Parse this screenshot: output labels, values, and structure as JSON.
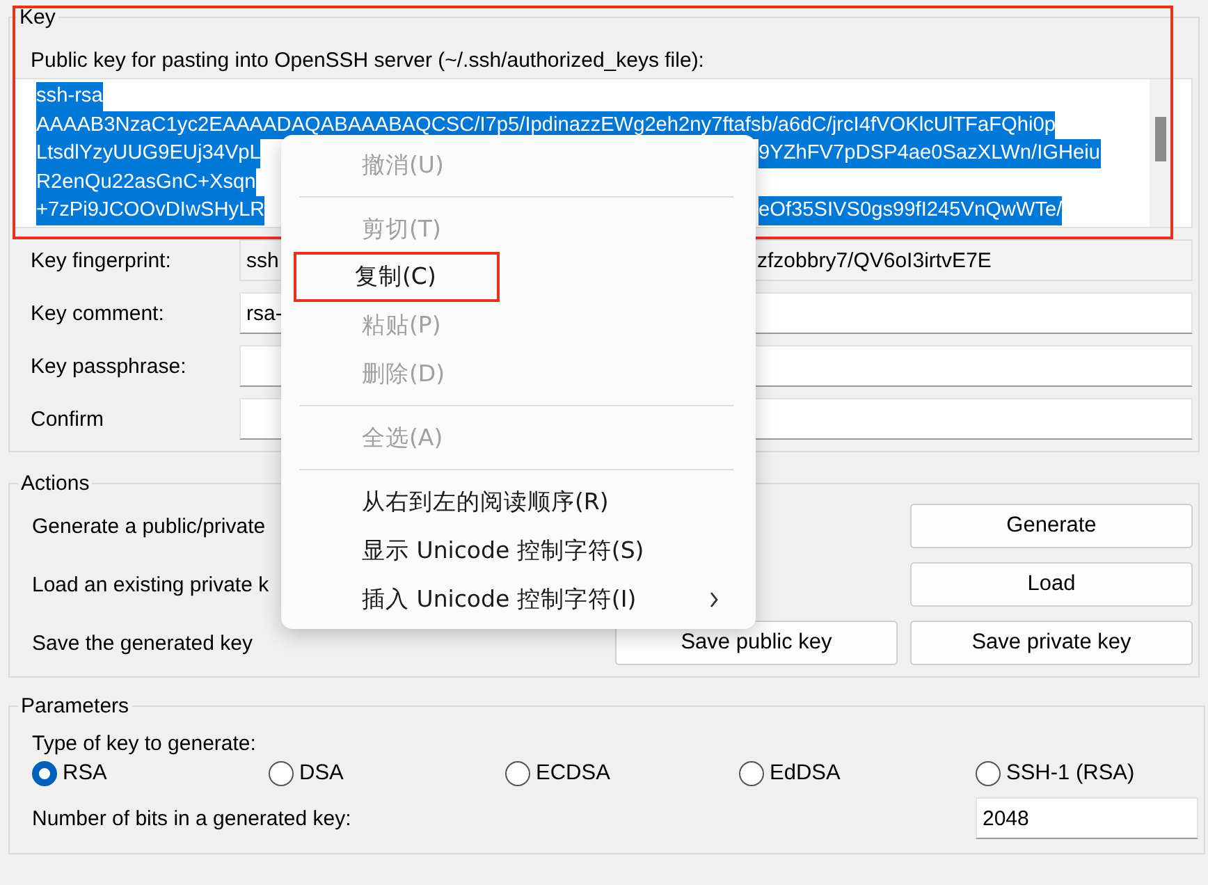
{
  "key_group": {
    "title": "Key",
    "annotated": true,
    "public_key_label": "Public key for pasting into OpenSSH server (~/.ssh/authorized_keys file):",
    "text_selected": true,
    "public_key_lines": [
      {
        "left": "ssh-rsa"
      },
      {
        "left": "AAAAB3NzaC1yc2EAAAADAQABAAABAQCSC/I7p5/IpdinazzEWg2eh2ny7ftafsb/a6dC/jrcI4fVOKlcUlTFaFQhi0p"
      },
      {
        "left": "LtsdlYzyUUG9EUj34VpL",
        "right": "9YZhFV7pDSP4ae0SazXLWn/IGHeiu"
      },
      {
        "left": "R2enQu22asGnC+Xsqn"
      },
      {
        "left": "+7zPi9JCOOvDIwSHyLR",
        "right": "eOf35SIVS0gs99fI245VnQwWTe/"
      }
    ],
    "fields": [
      {
        "label": "Key fingerprint:",
        "value_left": "ssh",
        "value_right": "zfzobbry7/QV6oI3irtvE7E",
        "readonly": true
      },
      {
        "label": "Key comment:",
        "value_left": "rsa-",
        "readonly": false
      },
      {
        "label": "Key passphrase:",
        "readonly": false
      },
      {
        "label": "Confirm",
        "readonly": false
      }
    ]
  },
  "actions": {
    "title": "Actions",
    "rows": [
      {
        "label": "Generate a public/private",
        "buttons": [
          "Generate"
        ]
      },
      {
        "label": "Load an existing private k",
        "buttons": [
          "Load"
        ]
      },
      {
        "label": "Save the generated key",
        "buttons": [
          "Save public key",
          "Save private key"
        ]
      }
    ]
  },
  "parameters": {
    "title": "Parameters",
    "type_label": "Type of key to generate:",
    "key_types": [
      {
        "label": "RSA",
        "selected": true
      },
      {
        "label": "DSA",
        "selected": false
      },
      {
        "label": "ECDSA",
        "selected": false
      },
      {
        "label": "EdDSA",
        "selected": false
      },
      {
        "label": "SSH-1 (RSA)",
        "selected": false
      }
    ],
    "bits_label": "Number of bits in a generated key:",
    "bits_value": "2048"
  },
  "context_menu": [
    {
      "kind": "item",
      "label": "撤消(U)",
      "disabled": true,
      "annotated": false
    },
    {
      "kind": "separator"
    },
    {
      "kind": "item",
      "label": "剪切(T)",
      "disabled": true,
      "annotated": false
    },
    {
      "kind": "item",
      "label": "复制(C)",
      "disabled": false,
      "annotated": true
    },
    {
      "kind": "item",
      "label": "粘贴(P)",
      "disabled": true,
      "annotated": false
    },
    {
      "kind": "item",
      "label": "删除(D)",
      "disabled": true,
      "annotated": false
    },
    {
      "kind": "separator"
    },
    {
      "kind": "item",
      "label": "全选(A)",
      "disabled": true,
      "annotated": false
    },
    {
      "kind": "separator"
    },
    {
      "kind": "item",
      "label": "从右到左的阅读顺序(R)",
      "disabled": false,
      "annotated": false
    },
    {
      "kind": "item",
      "label": "显示 Unicode 控制字符(S)",
      "disabled": false,
      "annotated": false
    },
    {
      "kind": "item",
      "label": "插入 Unicode 控制字符(I)",
      "disabled": false,
      "annotated": false,
      "submenu": true
    }
  ]
}
